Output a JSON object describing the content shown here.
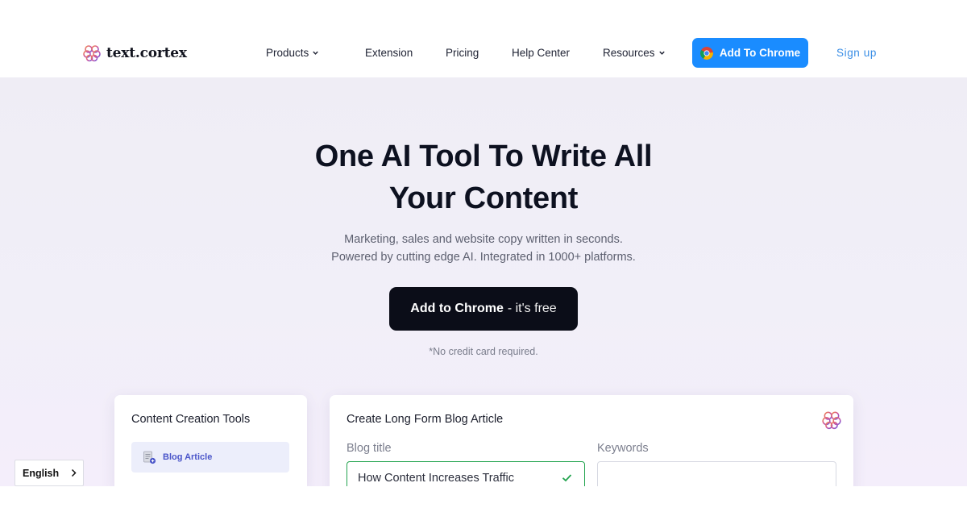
{
  "nav": {
    "logo_text": "text.cortex",
    "logo_icon": "brain-icon",
    "items": [
      {
        "label": "Products",
        "has_dropdown": true
      },
      {
        "label": "Extension",
        "has_dropdown": false
      },
      {
        "label": "Pricing",
        "has_dropdown": false
      },
      {
        "label": "Help Center",
        "has_dropdown": false
      },
      {
        "label": "Resources",
        "has_dropdown": true
      }
    ],
    "add_to_chrome_label": "Add To Chrome",
    "signup_label": "Sign up"
  },
  "hero": {
    "title_line1": "One AI Tool To Write All",
    "title_line2": "Your Content",
    "subtitle_line1": "Marketing, sales and website copy written in seconds.",
    "subtitle_line2": "Powered by cutting edge AI. Integrated in 1000+ platforms.",
    "cta_main": "Add to Chrome",
    "cta_suffix": "- it's free",
    "note": "*No credit card required."
  },
  "tools_card": {
    "title": "Content Creation Tools",
    "items": [
      {
        "label": "Blog Article",
        "icon": "document-icon"
      }
    ]
  },
  "blog_card": {
    "title": "Create Long Form Blog Article",
    "blog_title_label": "Blog title",
    "blog_title_value": "How Content Increases Traffic",
    "keywords_label": "Keywords",
    "keywords_value": ""
  },
  "language": {
    "selected": "English"
  },
  "colors": {
    "accent_blue": "#1a8cff",
    "cta_dark": "#0b0d18",
    "valid_green": "#23a44f",
    "tool_highlight": "#eceefb"
  }
}
